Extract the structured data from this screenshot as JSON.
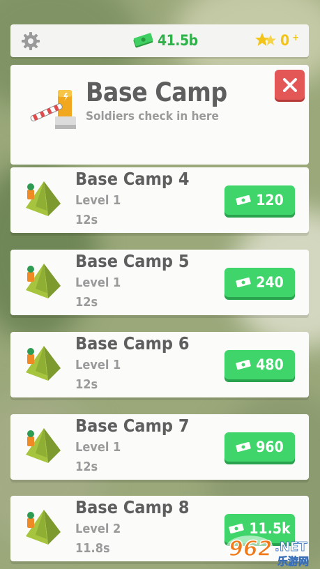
{
  "topbar": {
    "money": "41.5b",
    "stars": "0",
    "plus": "+"
  },
  "header": {
    "title": "Base Camp",
    "subtitle": "Soldiers check in here"
  },
  "camps": [
    {
      "name": "Base Camp 4",
      "level": "Level 1",
      "time": "12s",
      "price": "120"
    },
    {
      "name": "Base Camp 5",
      "level": "Level 1",
      "time": "12s",
      "price": "240"
    },
    {
      "name": "Base Camp 6",
      "level": "Level 1",
      "time": "12s",
      "price": "480"
    },
    {
      "name": "Base Camp 7",
      "level": "Level 1",
      "time": "12s",
      "price": "960"
    },
    {
      "name": "Base Camp 8",
      "level": "Level 2",
      "time": "11.8s",
      "price": "11.5k"
    }
  ],
  "watermark": {
    "brand": "962",
    "domain": ".NET",
    "sub": "乐游网"
  },
  "colors": {
    "accent_green": "#3fd56a",
    "money_green": "#2fb24a",
    "close_red": "#e45757",
    "star_yellow": "#f2c419"
  }
}
